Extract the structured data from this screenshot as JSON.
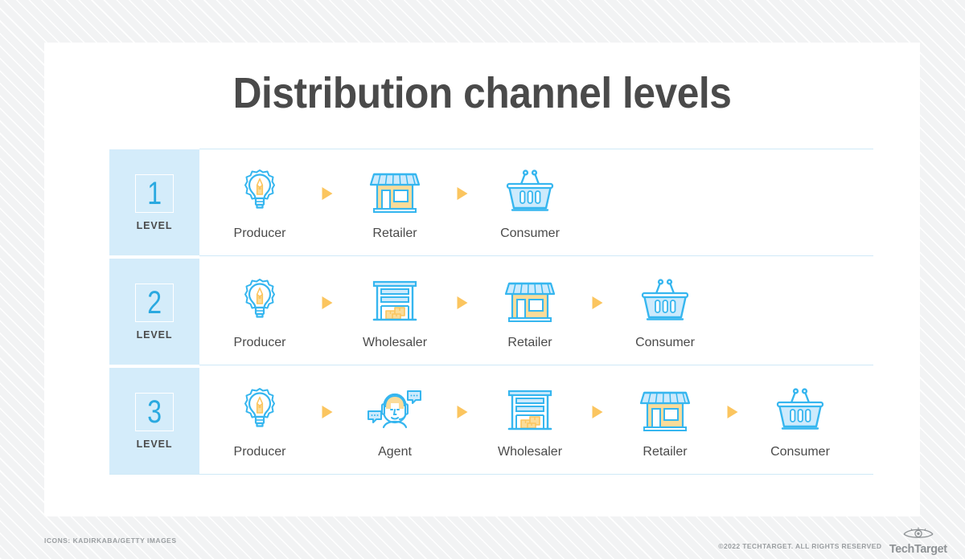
{
  "page": {
    "title": "Distribution channel levels"
  },
  "table": {
    "level_word": "LEVEL",
    "rows": [
      {
        "number": "1",
        "nodes": [
          {
            "label": "Producer",
            "icon": "lightbulb-gear-icon"
          },
          {
            "label": "Retailer",
            "icon": "storefront-icon"
          },
          {
            "label": "Consumer",
            "icon": "shopping-basket-icon"
          }
        ]
      },
      {
        "number": "2",
        "nodes": [
          {
            "label": "Producer",
            "icon": "lightbulb-gear-icon"
          },
          {
            "label": "Wholesaler",
            "icon": "warehouse-icon"
          },
          {
            "label": "Retailer",
            "icon": "storefront-icon"
          },
          {
            "label": "Consumer",
            "icon": "shopping-basket-icon"
          }
        ]
      },
      {
        "number": "3",
        "nodes": [
          {
            "label": "Producer",
            "icon": "lightbulb-gear-icon"
          },
          {
            "label": "Agent",
            "icon": "headset-person-icon"
          },
          {
            "label": "Wholesaler",
            "icon": "warehouse-icon"
          },
          {
            "label": "Retailer",
            "icon": "storefront-icon"
          },
          {
            "label": "Consumer",
            "icon": "shopping-basket-icon"
          }
        ]
      }
    ]
  },
  "footer": {
    "credit": "ICONS: KADIRKABA/GETTY IMAGES",
    "copyright": "©2022 TECHTARGET. ALL RIGHTS RESERVED",
    "logo_text": "TechTarget",
    "logo_icon": "eye-icon"
  },
  "colors": {
    "accent_blue": "#29a8e0",
    "icon_blue": "#36b6ef",
    "icon_fill_blue": "#cdeafc",
    "accent_yellow": "#fbc55f",
    "icon_fill_yellow": "#fbdc99",
    "level_cell_bg": "#d4ecfa",
    "divider": "#cfe9f7",
    "text_dark": "#4a4a4a",
    "page_bg": "#f3f4f5"
  }
}
